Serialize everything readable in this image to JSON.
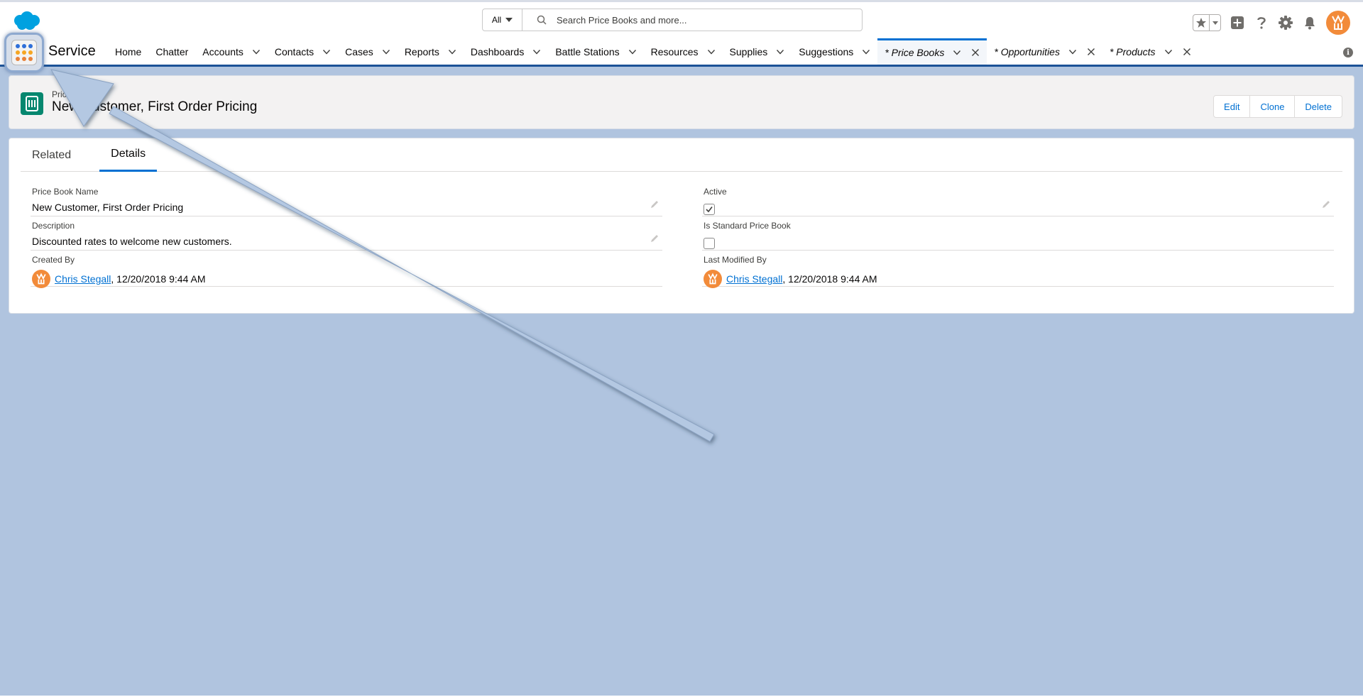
{
  "header": {
    "search_scope": "All",
    "search_placeholder": "Search Price Books and more..."
  },
  "nav": {
    "app_name": "Service",
    "items": [
      {
        "label": "Home",
        "has_menu": false
      },
      {
        "label": "Chatter",
        "has_menu": false
      },
      {
        "label": "Accounts",
        "has_menu": true
      },
      {
        "label": "Contacts",
        "has_menu": true
      },
      {
        "label": "Cases",
        "has_menu": true
      },
      {
        "label": "Reports",
        "has_menu": true
      },
      {
        "label": "Dashboards",
        "has_menu": true
      },
      {
        "label": "Battle Stations",
        "has_menu": true
      },
      {
        "label": "Resources",
        "has_menu": true
      },
      {
        "label": "Supplies",
        "has_menu": true
      },
      {
        "label": "Suggestions",
        "has_menu": true
      }
    ],
    "workspace_tabs": [
      {
        "label": "* Price Books",
        "active": true
      },
      {
        "label": "* Opportunities",
        "active": false
      },
      {
        "label": "* Products",
        "active": false
      }
    ]
  },
  "record": {
    "type_label": "Price Book",
    "title": "New Customer, First Order Pricing",
    "actions": [
      "Edit",
      "Clone",
      "Delete"
    ]
  },
  "tabs": {
    "related": "Related",
    "details": "Details",
    "active": "Details"
  },
  "fields": {
    "price_book_name": {
      "label": "Price Book Name",
      "value": "New Customer, First Order Pricing"
    },
    "active": {
      "label": "Active",
      "checked": true
    },
    "description": {
      "label": "Description",
      "value": "Discounted rates to welcome new customers."
    },
    "is_standard": {
      "label": "Is Standard Price Book",
      "checked": false
    },
    "created_by": {
      "label": "Created By",
      "user": "Chris Stegall",
      "date": ", 12/20/2018 9:44 AM"
    },
    "last_modified_by": {
      "label": "Last Modified By",
      "user": "Chris Stegall",
      "date": ", 12/20/2018 9:44 AM"
    }
  },
  "icons": {
    "logo": "salesforce-cloud-icon",
    "app_launcher": "app-launcher-grid-icon",
    "search": "search-icon",
    "favorites": "star-icon",
    "global_create": "plus-icon",
    "help": "question-icon",
    "setup": "gear-icon",
    "notifications": "bell-icon",
    "record": "price-book-icon",
    "pencil": "pencil-icon"
  },
  "colors": {
    "brand_blue": "#0070d2",
    "nav_border": "#1b5297",
    "record_icon": "#06876f",
    "avatar": "#f28b3a",
    "background": "#b0c4df",
    "arrow": "#b4c8e2"
  }
}
